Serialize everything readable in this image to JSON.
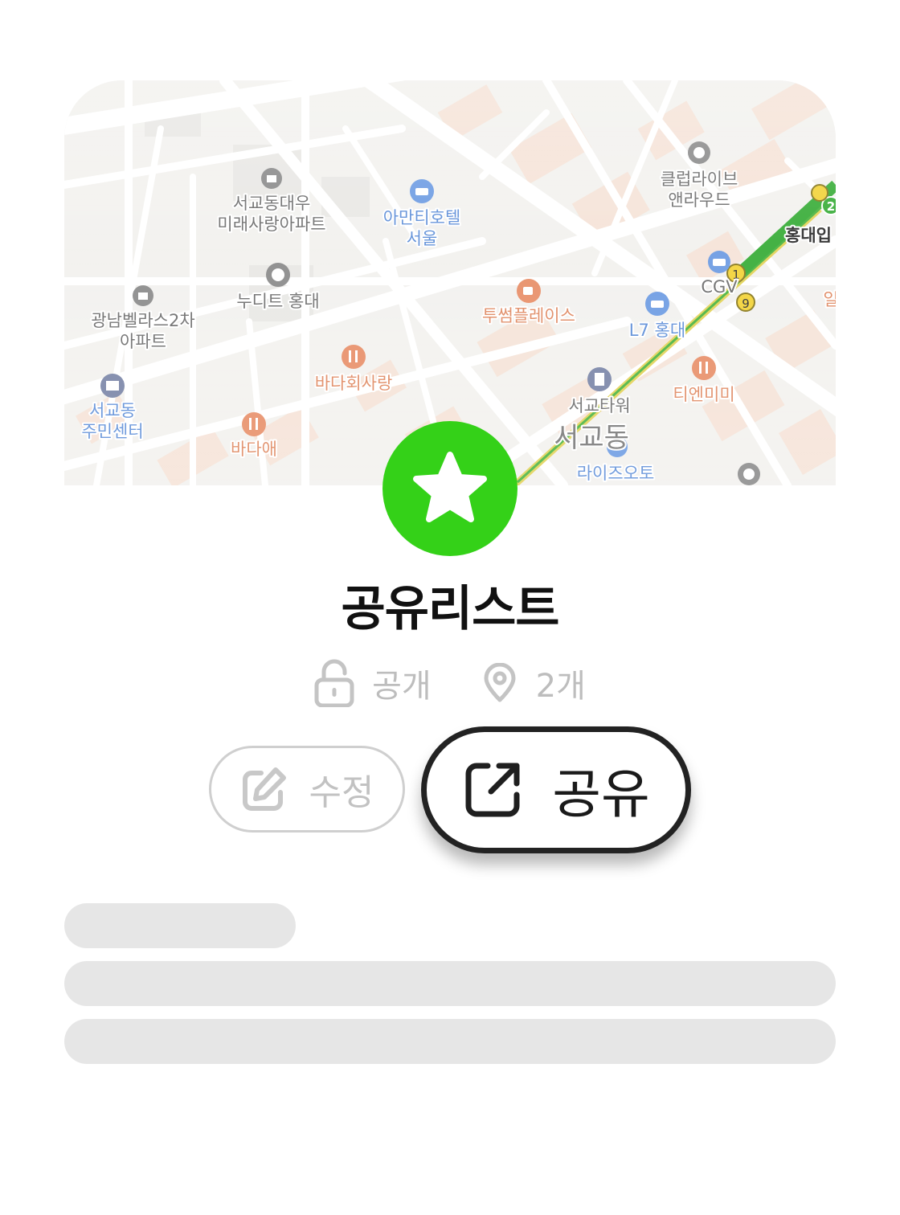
{
  "map": {
    "labels": {
      "seogyo_daewoo_1": "서교동대우",
      "seogyo_daewoo_2": "미래사랑아파트",
      "amanti_1": "아만티호텔",
      "amanti_2": "서울",
      "club_1": "클럽라이브",
      "club_2": "앤라우드",
      "hongdae_station": "홍대입",
      "gwangnam_1": "광남벨라스2차",
      "gwangnam_2": "아파트",
      "noodit": "누디트 홍대",
      "tosome": "투썸플레이스",
      "cgv": "CGV",
      "l7": "L7 홍대",
      "bada_hoe": "바다회사랑",
      "seogyo_center_1": "서교동",
      "seogyo_center_2": "주민센터",
      "seogyo_tower": "서교타워",
      "tienmimi": "티엔미미",
      "seogyo_district": "서교동",
      "bada_ae": "바다애",
      "rise": "라이즈오토",
      "edge_char": "일",
      "line_badge_1": "1",
      "line_badge_2": "2",
      "line_badge_9": "9"
    }
  },
  "badge": {
    "icon": "star-icon",
    "color": "#34d118"
  },
  "list": {
    "title": "공유리스트",
    "visibility": "공개",
    "place_count": "2개"
  },
  "actions": {
    "edit_label": "수정",
    "share_label": "공유"
  },
  "colors": {
    "accent": "#34d118",
    "muted_text": "#bdbdbd",
    "skeleton": "#e6e6e6"
  }
}
